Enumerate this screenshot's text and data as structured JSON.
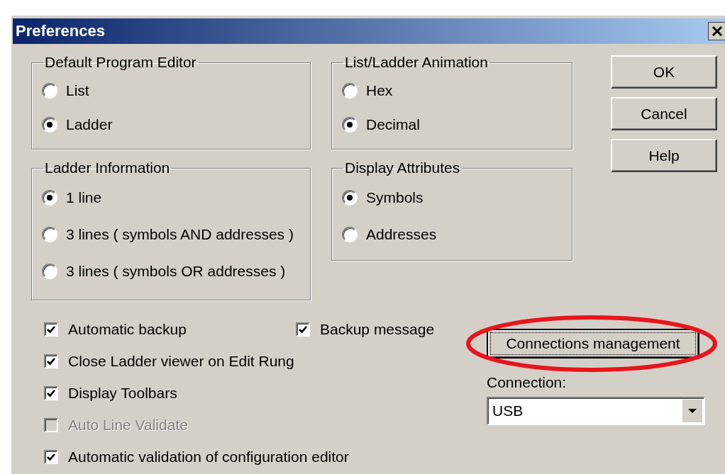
{
  "window": {
    "title": "Preferences"
  },
  "groups": [
    {
      "title": "Default Program Editor",
      "options": [
        {
          "label": "List",
          "selected": false
        },
        {
          "label": "Ladder",
          "selected": true
        }
      ]
    },
    {
      "title": "List/Ladder Animation",
      "options": [
        {
          "label": "Hex",
          "selected": false
        },
        {
          "label": "Decimal",
          "selected": true
        }
      ]
    },
    {
      "title": "Ladder Information",
      "options": [
        {
          "label": "1 line",
          "selected": true
        },
        {
          "label": "3 lines ( symbols AND addresses )",
          "selected": false
        },
        {
          "label": "3 lines ( symbols OR addresses )",
          "selected": false
        }
      ]
    },
    {
      "title": "Display Attributes",
      "options": [
        {
          "label": "Symbols",
          "selected": true
        },
        {
          "label": "Addresses",
          "selected": false
        }
      ]
    }
  ],
  "buttons": [
    {
      "label": "OK"
    },
    {
      "label": "Cancel"
    },
    {
      "label": "Help"
    }
  ],
  "checkboxes": [
    {
      "label": "Automatic backup",
      "checked": true,
      "disabled": false
    },
    {
      "label": "Backup message",
      "checked": true,
      "disabled": false
    },
    {
      "label": "Close Ladder viewer on Edit Rung",
      "checked": true,
      "disabled": false
    },
    {
      "label": "Display Toolbars",
      "checked": true,
      "disabled": false
    },
    {
      "label": "Auto Line Validate",
      "checked": false,
      "disabled": true
    },
    {
      "label": "Automatic validation of configuration editor",
      "checked": true,
      "disabled": false
    }
  ],
  "connections_button": {
    "label": "Connections management",
    "focused": true,
    "highlighted": true
  },
  "connection": {
    "label": "Connection:",
    "value": "USB"
  }
}
